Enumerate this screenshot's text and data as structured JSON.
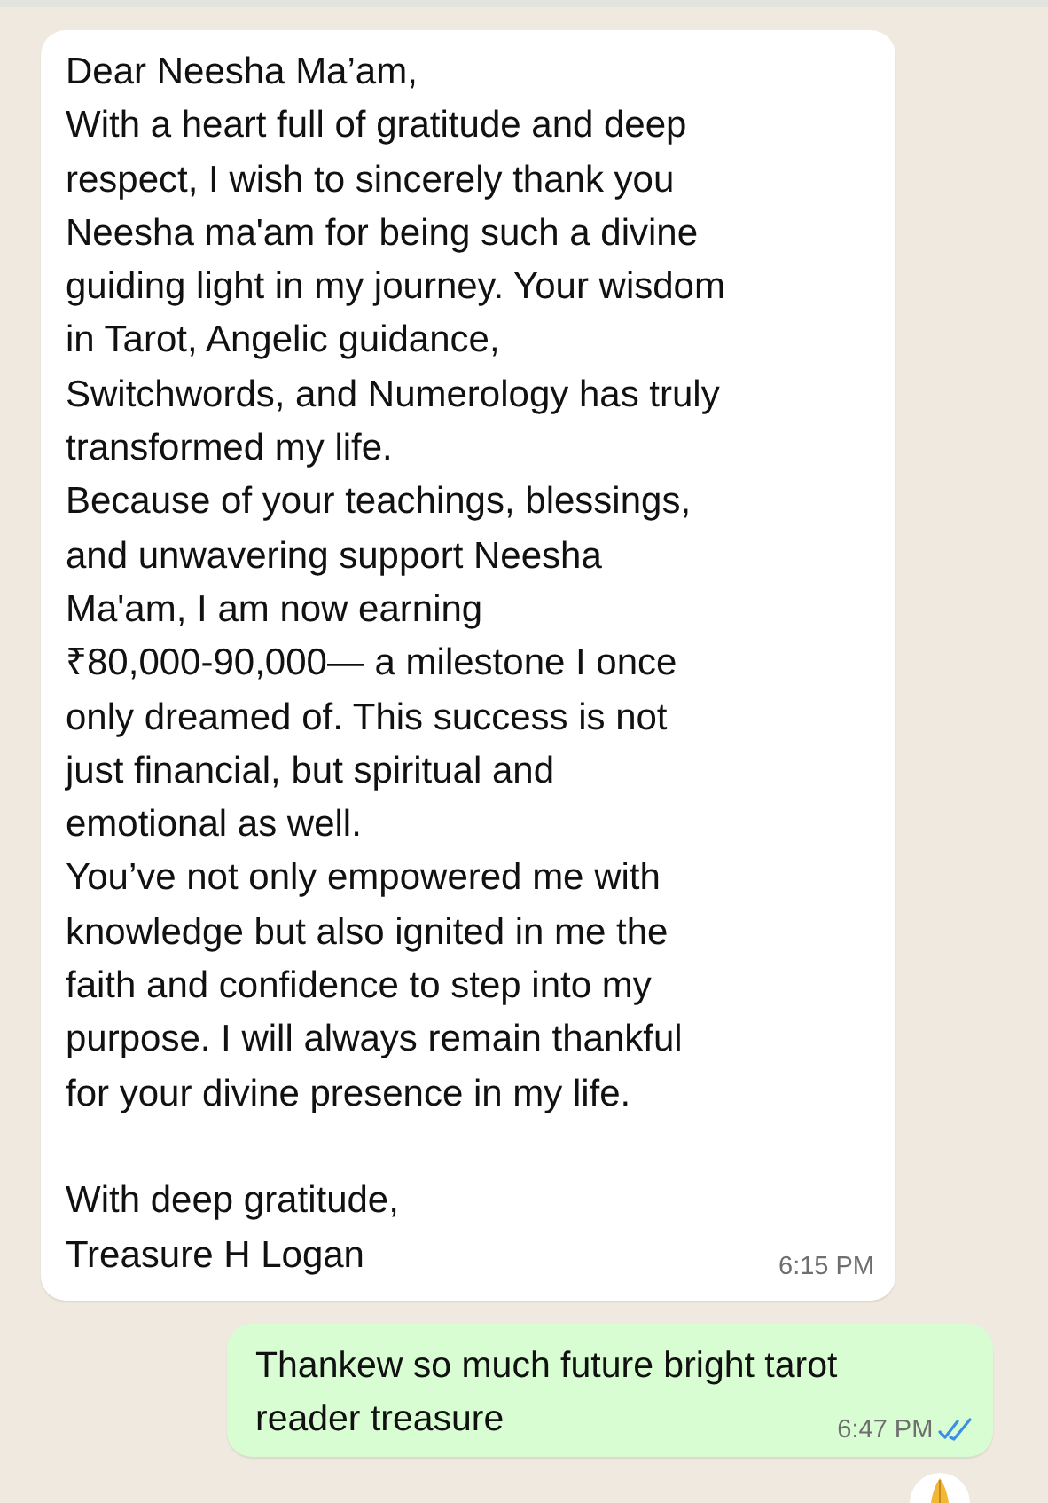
{
  "messages": [
    {
      "kind": "incoming",
      "text": "Dear Neesha Ma’am,\nWith a heart full of gratitude and deep\nrespect, I wish to sincerely thank you\nNeesha ma'am for being such a divine\nguiding light in my journey. Your wisdom\nin Tarot, Angelic guidance,\nSwitchwords, and Numerology has truly\ntransformed my life.\nBecause of your teachings, blessings,\nand unwavering support Neesha\nMa'am, I am now earning\n₹80,000-90,000— a milestone I once\nonly dreamed of. This success is not\njust financial, but spiritual and\nemotional as well.\nYou’ve not only empowered me with\nknowledge but also ignited in me the\nfaith and confidence to step into my\npurpose. I will always remain thankful\nfor your divine presence in my life.\n\nWith deep gratitude,\nTreasure H Logan",
      "time": "6:15 PM"
    },
    {
      "kind": "outgoing",
      "text": "Thankew so much future bright tarot\nreader treasure",
      "time": "6:47 PM",
      "read": true,
      "reaction": true
    }
  ]
}
